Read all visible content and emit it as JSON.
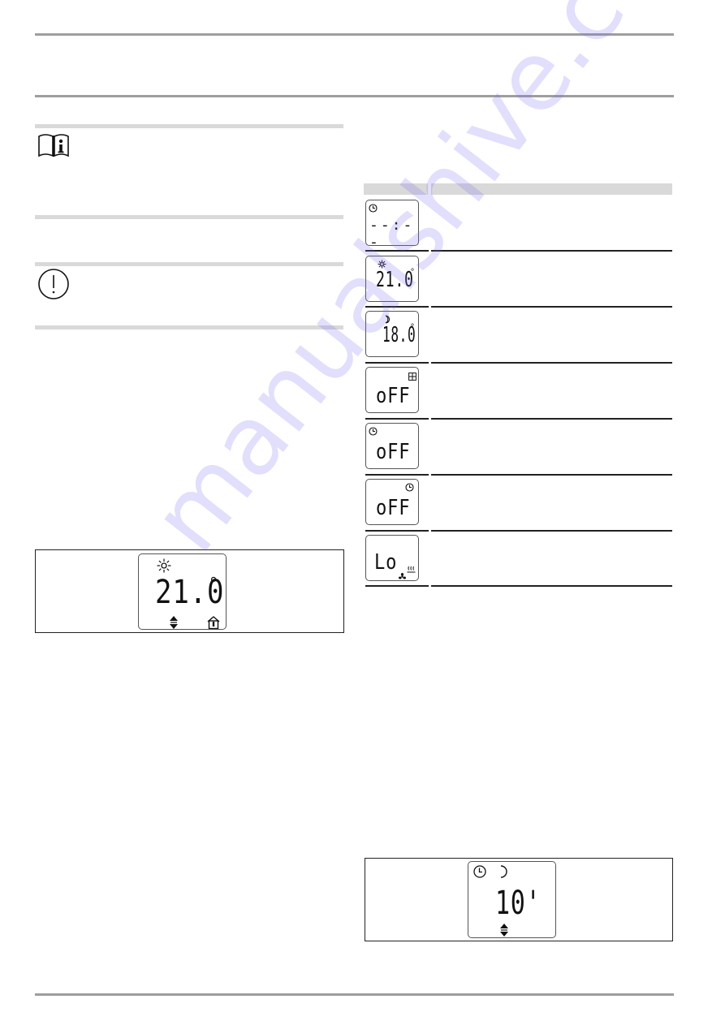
{
  "page": {
    "header_rules": 2,
    "footer_rules": 1,
    "watermark": "manualshive.com"
  },
  "notices": [
    {
      "type": "info",
      "icon": "book-info-icon"
    },
    {
      "type": "spacer"
    },
    {
      "type": "caution",
      "icon": "exclamation-circle-icon"
    }
  ],
  "figure_main": {
    "icon_top": "sun-icon",
    "value": "21.0",
    "unit": "°",
    "icon_bottom_left": "up-down-arrows-icon",
    "icon_bottom_right": "house-thermometer-icon"
  },
  "table": {
    "columns": [
      "",
      ""
    ],
    "rows": [
      {
        "icon": "clock-icon",
        "display": "--:--",
        "icon_pos": "top-left"
      },
      {
        "icon": "sun-icon",
        "display": "21.0",
        "unit": "°",
        "icon_pos": "top-left"
      },
      {
        "icon": "moon-icon",
        "display": "18.0",
        "unit": "°",
        "icon_pos": "top-left"
      },
      {
        "icon": "window-icon",
        "display": "oFF",
        "icon_pos": "top-right"
      },
      {
        "icon": "clock-icon",
        "display": "oFF",
        "icon_pos": "top-left"
      },
      {
        "icon": "clock-icon",
        "display": "oFF",
        "icon_pos": "top-right"
      },
      {
        "icon": "fan-heat-icon",
        "display": "Lo",
        "icon_pos": "bottom-right"
      }
    ]
  },
  "figure_timer": {
    "icon_left": "clock-icon",
    "icon_right": "moon-icon",
    "value": "10'",
    "icon_bottom": "up-down-arrows-icon"
  }
}
